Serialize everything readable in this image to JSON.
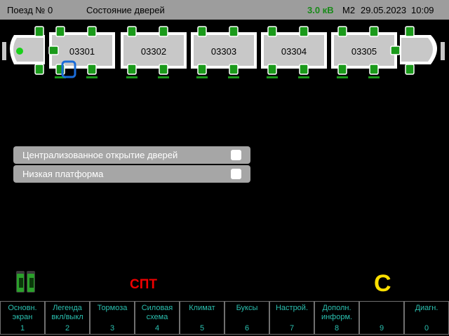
{
  "header": {
    "train": "Поезд № 0",
    "title": "Состояние дверей",
    "voltage": "3.0 кВ",
    "mode": "М2",
    "date": "29.05.2023",
    "time": "10:09"
  },
  "cars": [
    "03301",
    "03302",
    "03303",
    "03304",
    "03305"
  ],
  "options": [
    {
      "label": "Централизованное открытие дверей",
      "checked": false
    },
    {
      "label": "Низкая платформа",
      "checked": false
    }
  ],
  "status": {
    "spt": "СПТ",
    "c_mark": "C"
  },
  "fkeys": [
    {
      "label": "Основн.\nэкран",
      "num": "1"
    },
    {
      "label": "Легенда\nвкл/выкл",
      "num": "2"
    },
    {
      "label": "Тормоза",
      "num": "3"
    },
    {
      "label": "Силовая\nсхема",
      "num": "4"
    },
    {
      "label": "Климат",
      "num": "5"
    },
    {
      "label": "Буксы",
      "num": "6"
    },
    {
      "label": "Настрой.",
      "num": "7"
    },
    {
      "label": "Дополн.\nинформ.",
      "num": "8"
    },
    {
      "label": "",
      "num": "9"
    },
    {
      "label": "Диагн.",
      "num": "0"
    }
  ],
  "colors": {
    "door_closed": "#1a9a1a",
    "door_selected": "#1a6cd8",
    "car": "#c8c8c8",
    "spt": "#e00000",
    "c_mark": "#ffe000"
  }
}
